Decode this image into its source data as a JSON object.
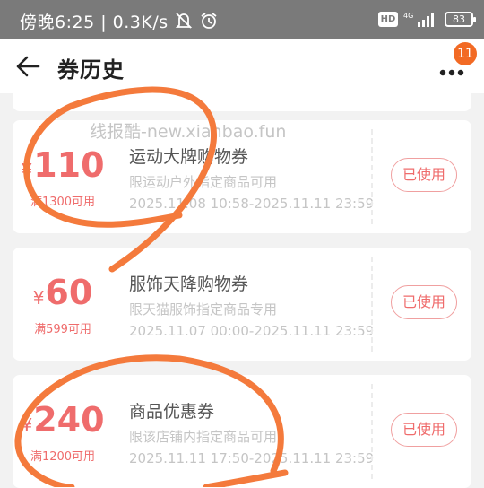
{
  "status_bar": {
    "time": "傍晚6:25",
    "speed": "0.3K/s",
    "network": "4G",
    "hd": "HD",
    "battery": "83"
  },
  "header": {
    "title": "券历史",
    "notification_count": "11"
  },
  "watermark": "线报酷-new.xianbao.fun",
  "coupons": [
    {
      "currency": "¥",
      "amount": "110",
      "condition": "满1300可用",
      "name": "运动大牌购物券",
      "description": "限运动户外指定商品可用",
      "validity": "2025.11.08 10:58-2025.11.11 23:59",
      "status_label": "已使用"
    },
    {
      "currency": "¥",
      "amount": "60",
      "condition": "满599可用",
      "name": "服饰天降购物券",
      "description": "限天猫服饰指定商品专用",
      "validity": "2025.11.07 00:00-2025.11.11 23:59",
      "status_label": "已使用"
    },
    {
      "currency": "¥",
      "amount": "240",
      "condition": "满1200可用",
      "name": "商品优惠券",
      "description": "限该店铺内指定商品可用",
      "validity": "2025.11.11 17:50-2025.11.11 23:59",
      "status_label": "已使用"
    }
  ],
  "colors": {
    "accent": "#ef6c6c",
    "badge": "#f26a24",
    "annotation": "#f47a3c"
  }
}
